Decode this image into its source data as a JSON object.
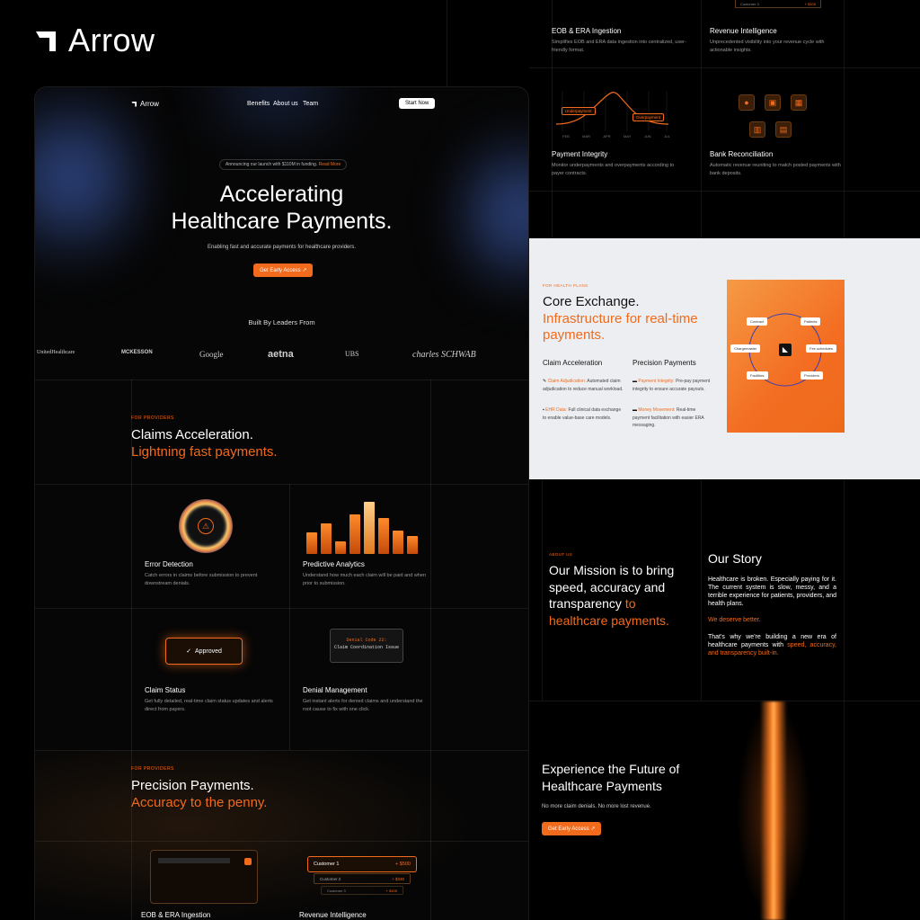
{
  "brand": {
    "name": "Arrow"
  },
  "mockup": {
    "nav": {
      "logo": "Arrow",
      "links": [
        "Benefits",
        "About us",
        "Team"
      ],
      "cta": "Start Now"
    },
    "announcement": {
      "text": "Announcing our launch with $110M in funding.",
      "link": "Read More"
    },
    "hero": {
      "title_line1": "Accelerating",
      "title_line2": "Healthcare Payments.",
      "subtitle": "Enabling fast and accurate payments for healthcare providers.",
      "cta": "Get Early Access ↗"
    },
    "built_by": "Built By Leaders From",
    "logos": [
      "UnitedHealthcare",
      "MCKESSON",
      "Google",
      "aetna",
      "UBS",
      "charles SCHWAB"
    ],
    "claims": {
      "label": "FOR PROVIDERS",
      "title": "Claims Acceleration.",
      "title_accent": "Lightning fast payments.",
      "cards": [
        {
          "title": "Error Detection",
          "desc": "Catch errors in claims before submission to prevent downstream denials."
        },
        {
          "title": "Predictive Analytics",
          "desc": "Understand how much each claim will be paid and when prior to submission."
        },
        {
          "title": "Claim Status",
          "desc": "Get fully detailed, real-time claim status updates and alerts direct from payers.",
          "badge": "Approved"
        },
        {
          "title": "Denial Management",
          "desc": "Get instant alerts for denied claims and understand the root cause to fix with one click.",
          "code_line1": "Denial Code 22:",
          "code_line2": "Claim Coordination Issue"
        }
      ]
    },
    "precision": {
      "label": "FOR PROVIDERS",
      "title": "Precision Payments.",
      "title_accent": "Accuracy to the penny.",
      "customers": [
        {
          "name": "Customer 1",
          "amount": "+ $500"
        },
        {
          "name": "Customer 2",
          "amount": "+ $330"
        },
        {
          "name": "Customer 3",
          "amount": "+ $105"
        }
      ],
      "card_titles": [
        "EOB & ERA Ingestion",
        "Revenue Intelligence"
      ]
    }
  },
  "features": [
    {
      "title": "EOB & ERA Ingestion",
      "desc": "Simplifies EOB and ERA data ingestion into centralized, user-friendly format."
    },
    {
      "title": "Revenue Intelligence",
      "desc": "Unprecedented visibility into your revenue cycle with actionable insights."
    },
    {
      "title": "Payment Integrity",
      "desc": "Monitor underpayments and overpayments according to payer contracts."
    },
    {
      "title": "Bank Reconciliation",
      "desc": "Automatic revenue reuniting to match posted payments with bank deposits."
    }
  ],
  "curve": {
    "months": [
      "FEB",
      "MAR",
      "APR",
      "MAY",
      "JUN",
      "JUL"
    ],
    "label_under": "Underpayment",
    "label_over": "Overpayment"
  },
  "top_customer": {
    "name": "Customer 3",
    "amount": "+ $105"
  },
  "exchange": {
    "label": "FOR HEALTH PLANS",
    "title": "Core Exchange.",
    "title_accent": "Infrastructure for real-time payments.",
    "col1": {
      "title": "Claim Acceleration",
      "items": [
        {
          "key": "Claim Adjudication:",
          "text": "Automated claim adjudication to reduce manual workload."
        },
        {
          "key": "EHR Data:",
          "text": "Full clinical data exchange to enable value-base care models."
        }
      ]
    },
    "col2": {
      "title": "Precision Payments",
      "items": [
        {
          "key": "Payment Integrity:",
          "text": "Pre-pay payment integrity to ensure accurate payouts."
        },
        {
          "key": "Money Movement:",
          "text": "Real-time payment facilitation with easier ERA messaging."
        }
      ]
    },
    "nodes": [
      "Contract",
      "Patients",
      "Chargemaster",
      "Fee schedules",
      "Facilities",
      "Providers"
    ]
  },
  "about": {
    "label": "ABOUT US",
    "mission_white": "Our Mission is to bring speed, accuracy and transparency",
    "mission_orange": "to healthcare payments.",
    "story_title": "Our Story",
    "story_p1": "Healthcare is broken. Especially paying for it. The current system is slow, messy, and a terrible experience for patients, providers, and health plans.",
    "story_p2": "We deserve better.",
    "story_p3_white": "That's why we're building a new era of healthcare payments with",
    "story_p3_orange": "speed, accuracy, and transparency built-in."
  },
  "future": {
    "title_line1": "Experience the Future of",
    "title_line2": "Healthcare Payments",
    "subtitle": "No more claim denials. No more lost revenue.",
    "cta": "Get Early Access ↗"
  },
  "colors": {
    "accent": "#f26a1b",
    "background": "#000000",
    "light_panel": "#eceef1"
  }
}
